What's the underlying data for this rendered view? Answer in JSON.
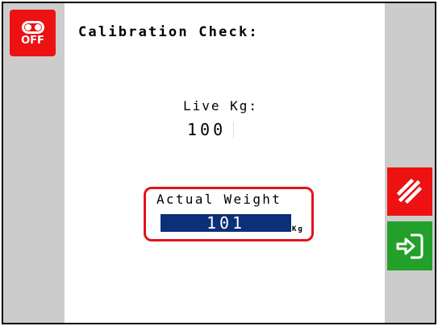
{
  "header": {
    "title": "Calibration Check:"
  },
  "off_button": {
    "label": "OFF",
    "icon": "off-toggle-icon"
  },
  "live": {
    "label": "Live Kg:",
    "value": "100"
  },
  "actual": {
    "label": "Actual Weight",
    "value": "101",
    "unit": "Kg"
  },
  "controls": {
    "cancel_icon": "cancel-slashes-icon",
    "next_icon": "next-arrow-icon"
  },
  "colors": {
    "red": "#ee1111",
    "green": "#22a02a",
    "field_blue": "#0b2f78",
    "panel_gray": "#cccccc",
    "highlight_red": "#e2131b"
  }
}
